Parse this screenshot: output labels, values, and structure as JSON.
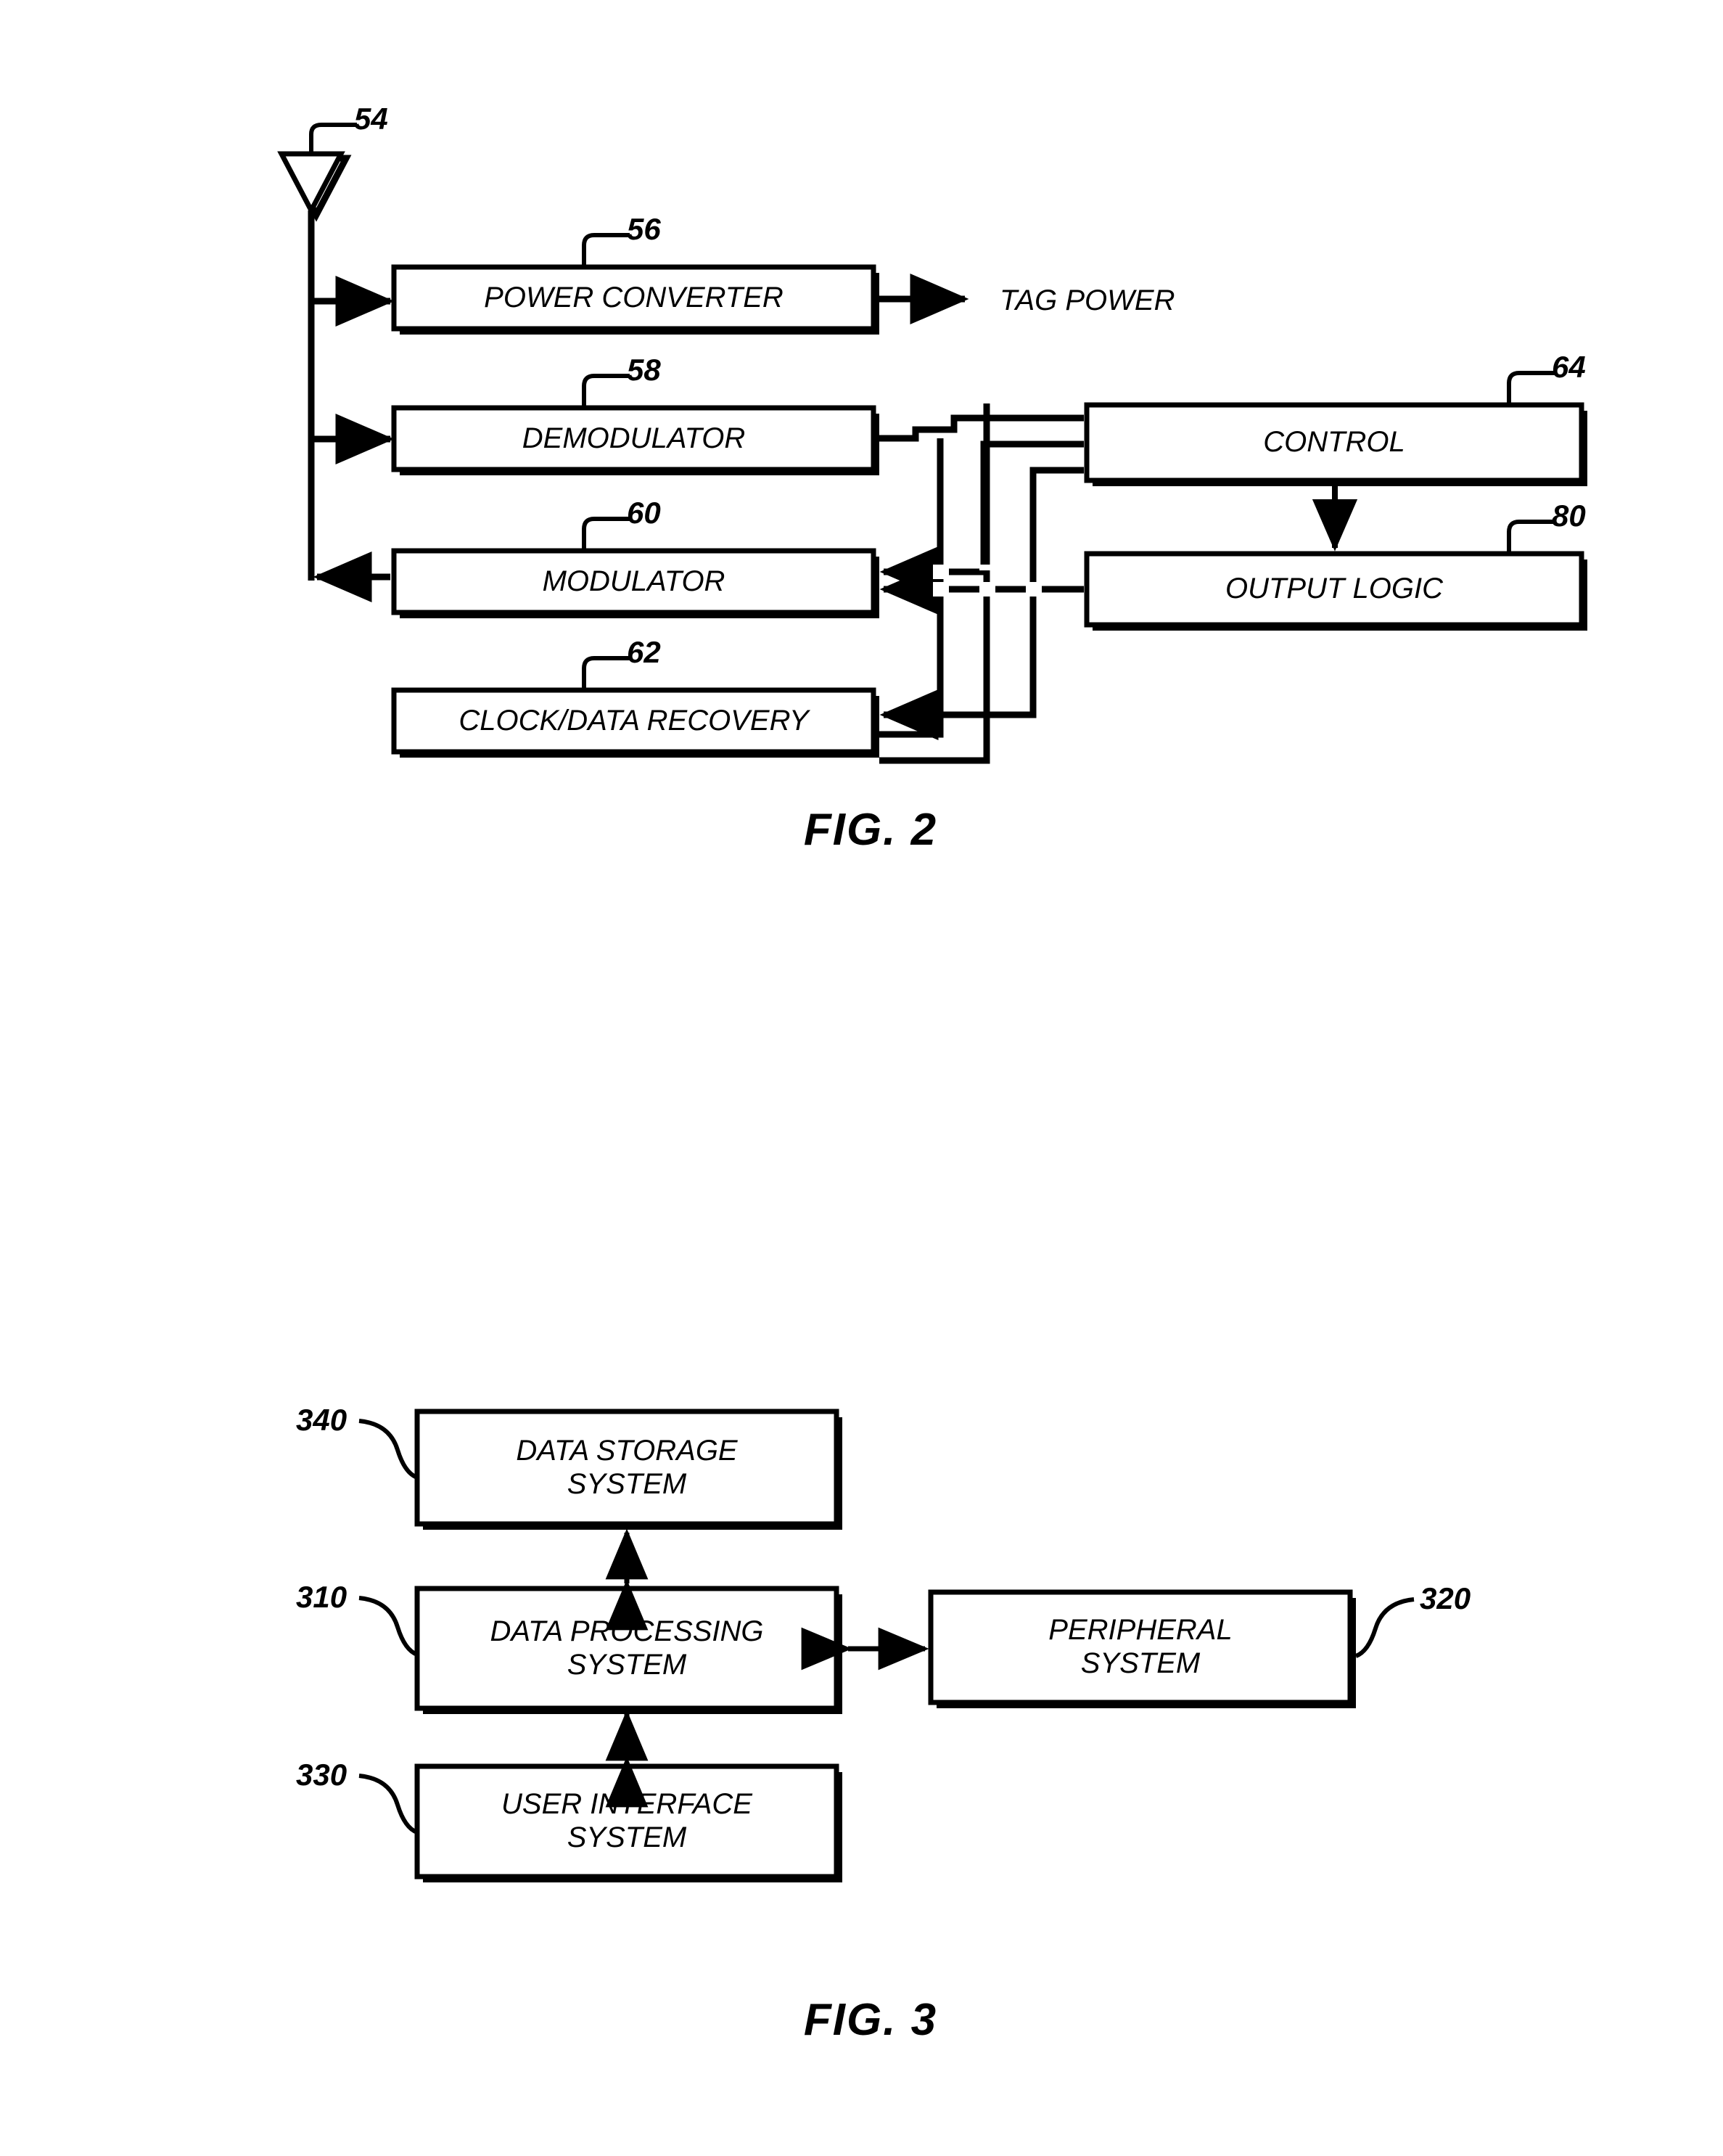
{
  "document": {
    "type": "patent-drawing-sheet",
    "figures": [
      {
        "id": "fig2",
        "caption": "FIG. 2",
        "components": [
          {
            "ref": "54",
            "label": "ANTENNA",
            "shape": "triangle-antenna"
          },
          {
            "ref": "56",
            "label": "POWER CONVERTER"
          },
          {
            "ref": "58",
            "label": "DEMODULATOR"
          },
          {
            "ref": "60",
            "label": "MODULATOR"
          },
          {
            "ref": "62",
            "label": "CLOCK/DATA RECOVERY"
          },
          {
            "ref": "64",
            "label": "CONTROL"
          },
          {
            "ref": "80",
            "label": "OUTPUT LOGIC"
          }
        ],
        "free_text": [
          {
            "name": "tag-power-output",
            "text": "TAG POWER"
          }
        ]
      },
      {
        "id": "fig3",
        "caption": "FIG. 3",
        "components": [
          {
            "ref": "340",
            "label": "DATA STORAGE\nSYSTEM",
            "line1": "DATA STORAGE",
            "line2": "SYSTEM"
          },
          {
            "ref": "310",
            "label": "DATA PROCESSING\nSYSTEM",
            "line1": "DATA PROCESSING",
            "line2": "SYSTEM"
          },
          {
            "ref": "320",
            "label": "PERIPHERAL\nSYSTEM",
            "line1": "PERIPHERAL",
            "line2": "SYSTEM"
          },
          {
            "ref": "330",
            "label": "USER INTERFACE\nSYSTEM",
            "line1": "USER INTERFACE",
            "line2": "SYSTEM"
          }
        ]
      }
    ]
  },
  "fig2": {
    "caption": "FIG. 2",
    "antenna": {
      "ref": "54",
      "name": "antenna-symbol"
    },
    "power_converter": {
      "ref": "56",
      "label": "POWER CONVERTER"
    },
    "demodulator": {
      "ref": "58",
      "label": "DEMODULATOR"
    },
    "modulator": {
      "ref": "60",
      "label": "MODULATOR"
    },
    "clock_data_recovery": {
      "ref": "62",
      "label": "CLOCK/DATA RECOVERY"
    },
    "control": {
      "ref": "64",
      "label": "CONTROL"
    },
    "output_logic": {
      "ref": "80",
      "label": "OUTPUT LOGIC"
    },
    "tag_power": "TAG POWER"
  },
  "fig3": {
    "caption": "FIG. 3",
    "data_storage": {
      "ref": "340",
      "line1": "DATA STORAGE",
      "line2": "SYSTEM"
    },
    "data_processing": {
      "ref": "310",
      "line1": "DATA PROCESSING",
      "line2": "SYSTEM"
    },
    "peripheral": {
      "ref": "320",
      "line1": "PERIPHERAL",
      "line2": "SYSTEM"
    },
    "user_interface": {
      "ref": "330",
      "line1": "USER INTERFACE",
      "line2": "SYSTEM"
    }
  },
  "colors": {
    "ink": "#000000",
    "page": "#ffffff"
  }
}
